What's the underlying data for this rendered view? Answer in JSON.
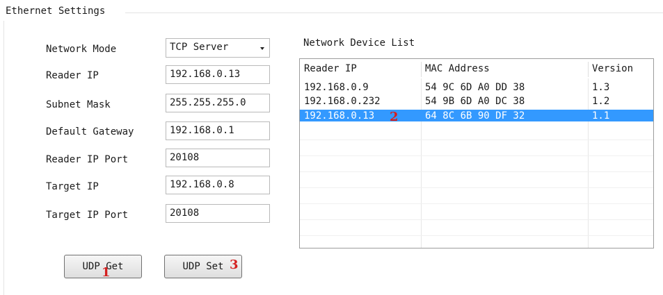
{
  "group": {
    "title": "Ethernet Settings"
  },
  "form": {
    "network_mode": {
      "label": "Network Mode",
      "value": "TCP Server"
    },
    "reader_ip": {
      "label": "Reader IP",
      "value": "192.168.0.13"
    },
    "subnet_mask": {
      "label": "Subnet Mask",
      "value": "255.255.255.0"
    },
    "default_gateway": {
      "label": "Default Gateway",
      "value": "192.168.0.1"
    },
    "reader_ip_port": {
      "label": "Reader IP Port",
      "value": "20108"
    },
    "target_ip": {
      "label": "Target IP",
      "value": "192.168.0.8"
    },
    "target_ip_port": {
      "label": "Target IP Port",
      "value": "20108"
    }
  },
  "device_list": {
    "title": "Network Device List",
    "columns": [
      "Reader IP",
      "MAC Address",
      "Version"
    ],
    "rows": [
      [
        "192.168.0.9",
        "54 9C 6D A0 DD 38",
        "1.3"
      ],
      [
        "192.168.0.232",
        "54 9B 6D A0 DC 38",
        "1.2"
      ],
      [
        "192.168.0.13",
        "64 8C 6B 90 DF 32",
        "1.1"
      ]
    ],
    "selected_row_index": 2
  },
  "buttons": {
    "udp_get": "UDP Get",
    "udp_set": "UDP Set"
  },
  "annotations": {
    "marker_1": "1",
    "marker_2": "2",
    "marker_3": "3"
  },
  "colors": {
    "selection": "#3399ff",
    "marker": "#d42020"
  }
}
